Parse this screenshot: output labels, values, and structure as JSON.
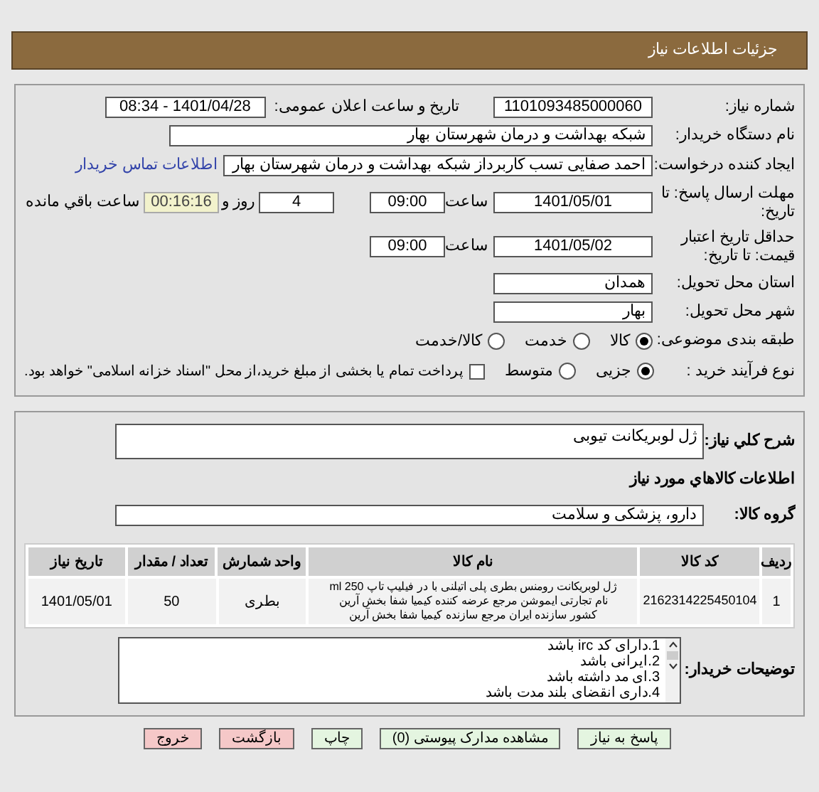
{
  "header": {
    "title": "جزئيات اطلاعات نياز"
  },
  "need_info": {
    "need_number_label": "شماره نیاز:",
    "need_number": "1101093485000060",
    "announce_label": "تاریخ و ساعت اعلان عمومی:",
    "announce_value": "1401/04/28 - 08:34",
    "buyer_label": "نام دستگاه خریدار:",
    "buyer": "شبکه بهداشت و درمان شهرستان بهار",
    "creator_label": "ایجاد کننده درخواست:",
    "creator": "احمد صفایی تسب کاربرداز شبکه بهداشت و درمان شهرستان بهار",
    "contact_link": "اطلاعات تماس خریدار",
    "deadline_label": "مهلت ارسال پاسخ: تا تاریخ:",
    "deadline_date": "1401/05/01",
    "deadline_time_label": "ساعت",
    "deadline_time": "09:00",
    "days": "4",
    "days_label": "روز و",
    "remaining": "00:16:16",
    "remaining_label": "ساعت باقي مانده",
    "validity_label": "حداقل تاریخ اعتبار قیمت: تا تاریخ:",
    "validity_date": "1401/05/02",
    "validity_time_label": "ساعت",
    "validity_time": "09:00",
    "province_label": "استان محل تحویل:",
    "province": "همدان",
    "city_label": "شهر محل تحویل:",
    "city": "بهار",
    "category_label": "طبقه بندی موضوعی:",
    "category_options": [
      {
        "label": "کالا",
        "selected": true
      },
      {
        "label": "خدمت",
        "selected": false
      },
      {
        "label": "کالا/خدمت",
        "selected": false
      }
    ],
    "process_label": "نوع فرآیند خرید :",
    "process_options": [
      {
        "label": "جزیی",
        "selected": true
      },
      {
        "label": "متوسط",
        "selected": false
      }
    ],
    "payment_checkbox": {
      "checked": false,
      "label": "پرداخت تمام یا بخشی از مبلغ خرید،از محل \"اسناد خزانه اسلامی\" خواهد بود."
    }
  },
  "goods": {
    "description_label": "شرح کلي نياز:",
    "description": "ژل لوبریکانت  تیوبی",
    "goods_heading": "اطلاعات کالاهاي مورد نياز",
    "group_label": "گروه کالا:",
    "group": "دارو، پزشکی و سلامت",
    "table": {
      "columns": [
        "ردیف",
        "کد کالا",
        "نام کالا",
        "واحد شمارش",
        "تعداد / مقدار",
        "تاریخ نیاز"
      ],
      "rows": [
        {
          "index": "1",
          "code": "2162314225450104",
          "name_lines": [
            "ژل لوبریکانت رومنس بطری پلی اتیلنی با در فیلیپ تاپ 250 ml",
            "نام تجارتی ایموشن مرجع عرضه کننده کیمیا شفا بخش آرین",
            "کشور سازنده ایران مرجع سازنده کیمیا شفا بخش آرین"
          ],
          "unit": "بطری",
          "quantity": "50",
          "date": "1401/05/01"
        }
      ]
    },
    "notes_label": "توضیحات خریدار:",
    "notes": [
      "1.دارای کد irc باشد",
      "2.ایرانی باشد",
      "3.ای مد داشته باشد",
      "4.داری انقضای بلند مدت باشد"
    ]
  },
  "buttons": [
    {
      "label": "پاسخ به نیاز",
      "kind": "normal"
    },
    {
      "label": "مشاهده مدارک پیوستی (0)",
      "kind": "normal"
    },
    {
      "label": "چاپ",
      "kind": "normal"
    },
    {
      "label": "بازگشت",
      "kind": "danger"
    },
    {
      "label": "خروج",
      "kind": "danger"
    }
  ]
}
